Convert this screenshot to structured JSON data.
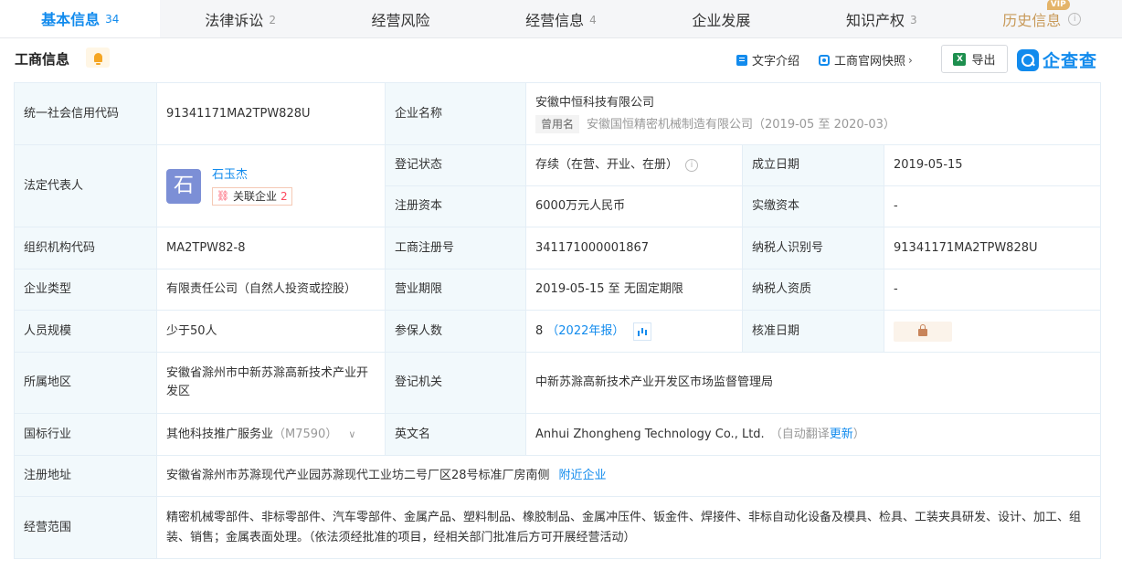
{
  "tabs": [
    {
      "label": "基本信息",
      "count": "34"
    },
    {
      "label": "法律诉讼",
      "count": "2"
    },
    {
      "label": "经营风险",
      "count": ""
    },
    {
      "label": "经营信息",
      "count": "4"
    },
    {
      "label": "企业发展",
      "count": ""
    },
    {
      "label": "知识产权",
      "count": "3"
    },
    {
      "label": "历史信息",
      "count": ""
    }
  ],
  "vip_badge": "VIP",
  "header": {
    "title": "工商信息",
    "text_intro": "文字介绍",
    "snapshot": "工商官网快照",
    "export": "导出",
    "logo": "企查查"
  },
  "fields": {
    "credit_code_label": "统一社会信用代码",
    "credit_code": "91341171MA2TPW828U",
    "company_name_label": "企业名称",
    "company_name": "安徽中恒科技有限公司",
    "former_name_tag": "曾用名",
    "former_name": "安徽国恒精密机械制造有限公司（2019-05 至 2020-03）",
    "legal_rep_label": "法定代表人",
    "legal_rep_avatar": "石",
    "legal_rep_name": "石玉杰",
    "related_label": "关联企业",
    "related_count": "2",
    "reg_status_label": "登记状态",
    "reg_status": "存续（在营、开业、在册）",
    "found_date_label": "成立日期",
    "found_date": "2019-05-15",
    "reg_capital_label": "注册资本",
    "reg_capital": "6000万元人民币",
    "paid_capital_label": "实缴资本",
    "paid_capital": "-",
    "org_code_label": "组织机构代码",
    "org_code": "MA2TPW82-8",
    "biz_reg_no_label": "工商注册号",
    "biz_reg_no": "341171000001867",
    "taxpayer_id_label": "纳税人识别号",
    "taxpayer_id": "91341171MA2TPW828U",
    "company_type_label": "企业类型",
    "company_type": "有限责任公司（自然人投资或控股）",
    "biz_term_label": "营业期限",
    "biz_term": "2019-05-15 至 无固定期限",
    "taxpayer_qual_label": "纳税人资质",
    "taxpayer_qual": "-",
    "staff_size_label": "人员规模",
    "staff_size": "少于50人",
    "insured_label": "参保人数",
    "insured_count": "8",
    "insured_year": "（2022年报）",
    "approval_date_label": "核准日期",
    "region_label": "所属地区",
    "region": "安徽省滁州市中新苏滁高新技术产业开发区",
    "reg_authority_label": "登记机关",
    "reg_authority": "中新苏滁高新技术产业开发区市场监督管理局",
    "industry_label": "国标行业",
    "industry": "其他科技推广服务业",
    "industry_code": "（M7590）",
    "english_name_label": "英文名",
    "english_name": "Anhui Zhongheng Technology Co., Ltd.",
    "auto_translate": "（自动翻译",
    "update": "更新",
    "close_paren": "）",
    "reg_address_label": "注册地址",
    "reg_address": "安徽省滁州市苏滁现代产业园苏滁现代工业坊二号厂区28号标准厂房南侧",
    "nearby": "附近企业",
    "biz_scope_label": "经营范围",
    "biz_scope": "精密机械零部件、非标零部件、汽车零部件、金属产品、塑料制品、橡胶制品、金属冲压件、钣金件、焊接件、非标自动化设备及模具、检具、工装夹具研发、设计、加工、组装、销售；金属表面处理。（依法须经批准的项目，经相关部门批准后方可开展经营活动）"
  }
}
